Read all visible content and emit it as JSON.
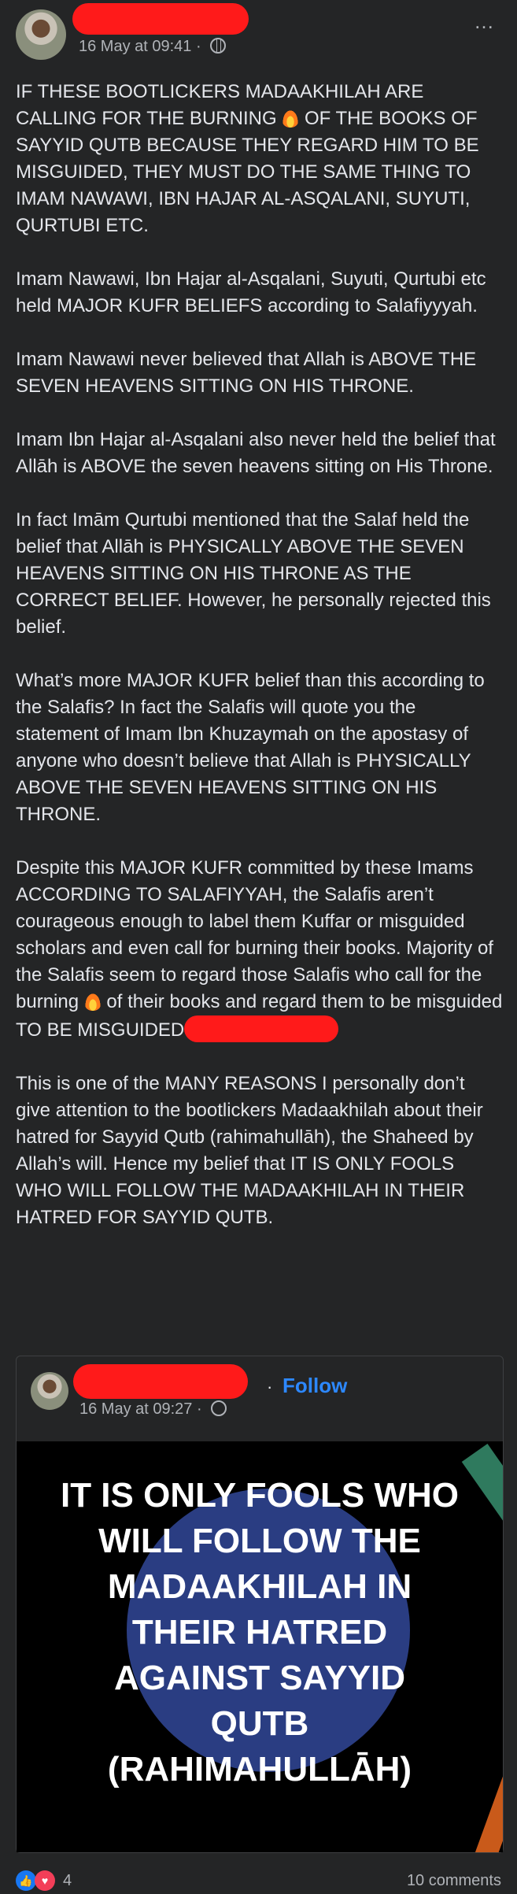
{
  "post": {
    "timestamp": "16 May at 09:41",
    "more_icon": "…",
    "paragraphs": [
      "IF THESE BOOTLICKERS MADAAKHILAH ARE CALLING FOR THE BURNING",
      "OF THE BOOKS OF SAYYID QUTB BECAUSE THEY REGARD HIM TO BE MISGUIDED, THEY MUST DO THE SAME THING TO IMAM NAWAWI, IBN HAJAR AL-ASQALANI, SUYUTI, QURTUBI ETC.",
      "Imam Nawawi, Ibn Hajar al-Asqalani, Suyuti, Qurtubi etc held MAJOR KUFR BELIEFS according to Salafiyyyah.",
      "Imam Nawawi never believed that Allah is ABOVE THE SEVEN HEAVENS SITTING ON HIS THRONE.",
      "Imam Ibn Hajar al-Asqalani also never held the belief that Allāh is ABOVE the seven heavens sitting on His Throne.",
      "In fact Imām Qurtubi mentioned that the Salaf held the belief that Allāh is PHYSICALLY ABOVE THE SEVEN HEAVENS SITTING ON HIS THRONE AS THE CORRECT BELIEF. However, he personally rejected this belief.",
      "What’s more MAJOR KUFR belief than this according to the Salafis? In fact the Salafis will quote you the statement of Imam Ibn Khuzaymah on the apostasy of anyone who doesn’t believe that Allah is PHYSICALLY ABOVE THE SEVEN HEAVENS SITTING ON HIS THRONE.",
      "Despite this MAJOR KUFR committed by these Imams ACCORDING TO SALAFIYYAH, the Salafis aren’t courageous enough to label them Kuffar or misguided scholars and even call for burning their books. Majority of the Salafis seem to regard those Salafis who call for the burning",
      "of their books and regard them to be misguided TO BE MISGUIDED",
      "This is one of the MANY REASONS I personally don’t give attention to the bootlickers Madaakhilah about their hatred for Sayyid Qutb (rahimahullāh), the Shaheed by Allah’s will. Hence my belief that IT IS ONLY FOOLS WHO WILL FOLLOW THE MADAAKHILAH IN THEIR HATRED FOR SAYYID QUTB."
    ]
  },
  "shared_post": {
    "follow_label": "Follow",
    "separator": "·",
    "timestamp": "16 May at 09:27",
    "image_text": "IT IS ONLY FOOLS WHO\nWILL FOLLOW THE\nMADAAKHILAH IN\nTHEIR HATRED\nAGAINST SAYYID\nQUTB\n(RAHIMAHULLĀH)"
  },
  "footer": {
    "reaction_count": "4",
    "comments": "10 comments"
  },
  "colors": {
    "background": "#242526",
    "text": "#e4e6eb",
    "link": "#2d88ff",
    "redaction": "#ff1a1a"
  }
}
